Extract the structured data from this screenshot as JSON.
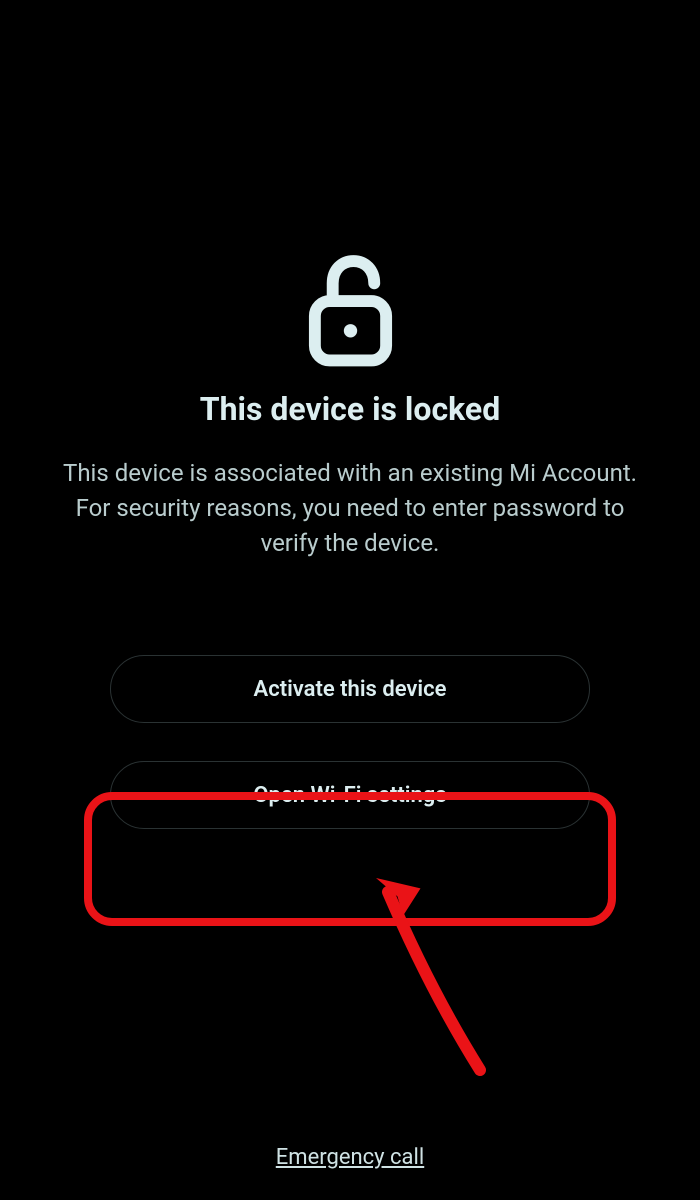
{
  "title": "This device is locked",
  "description": "This device is associated with an existing Mi Account. For security reasons, you need to enter password to verify the device.",
  "buttons": {
    "activate": "Activate this device",
    "wifi": "Open Wi-Fi settings"
  },
  "emergency": "Emergency call",
  "colors": {
    "highlight": "#ea1317",
    "text_primary": "#dceef0",
    "text_secondary": "#b9cccd"
  }
}
